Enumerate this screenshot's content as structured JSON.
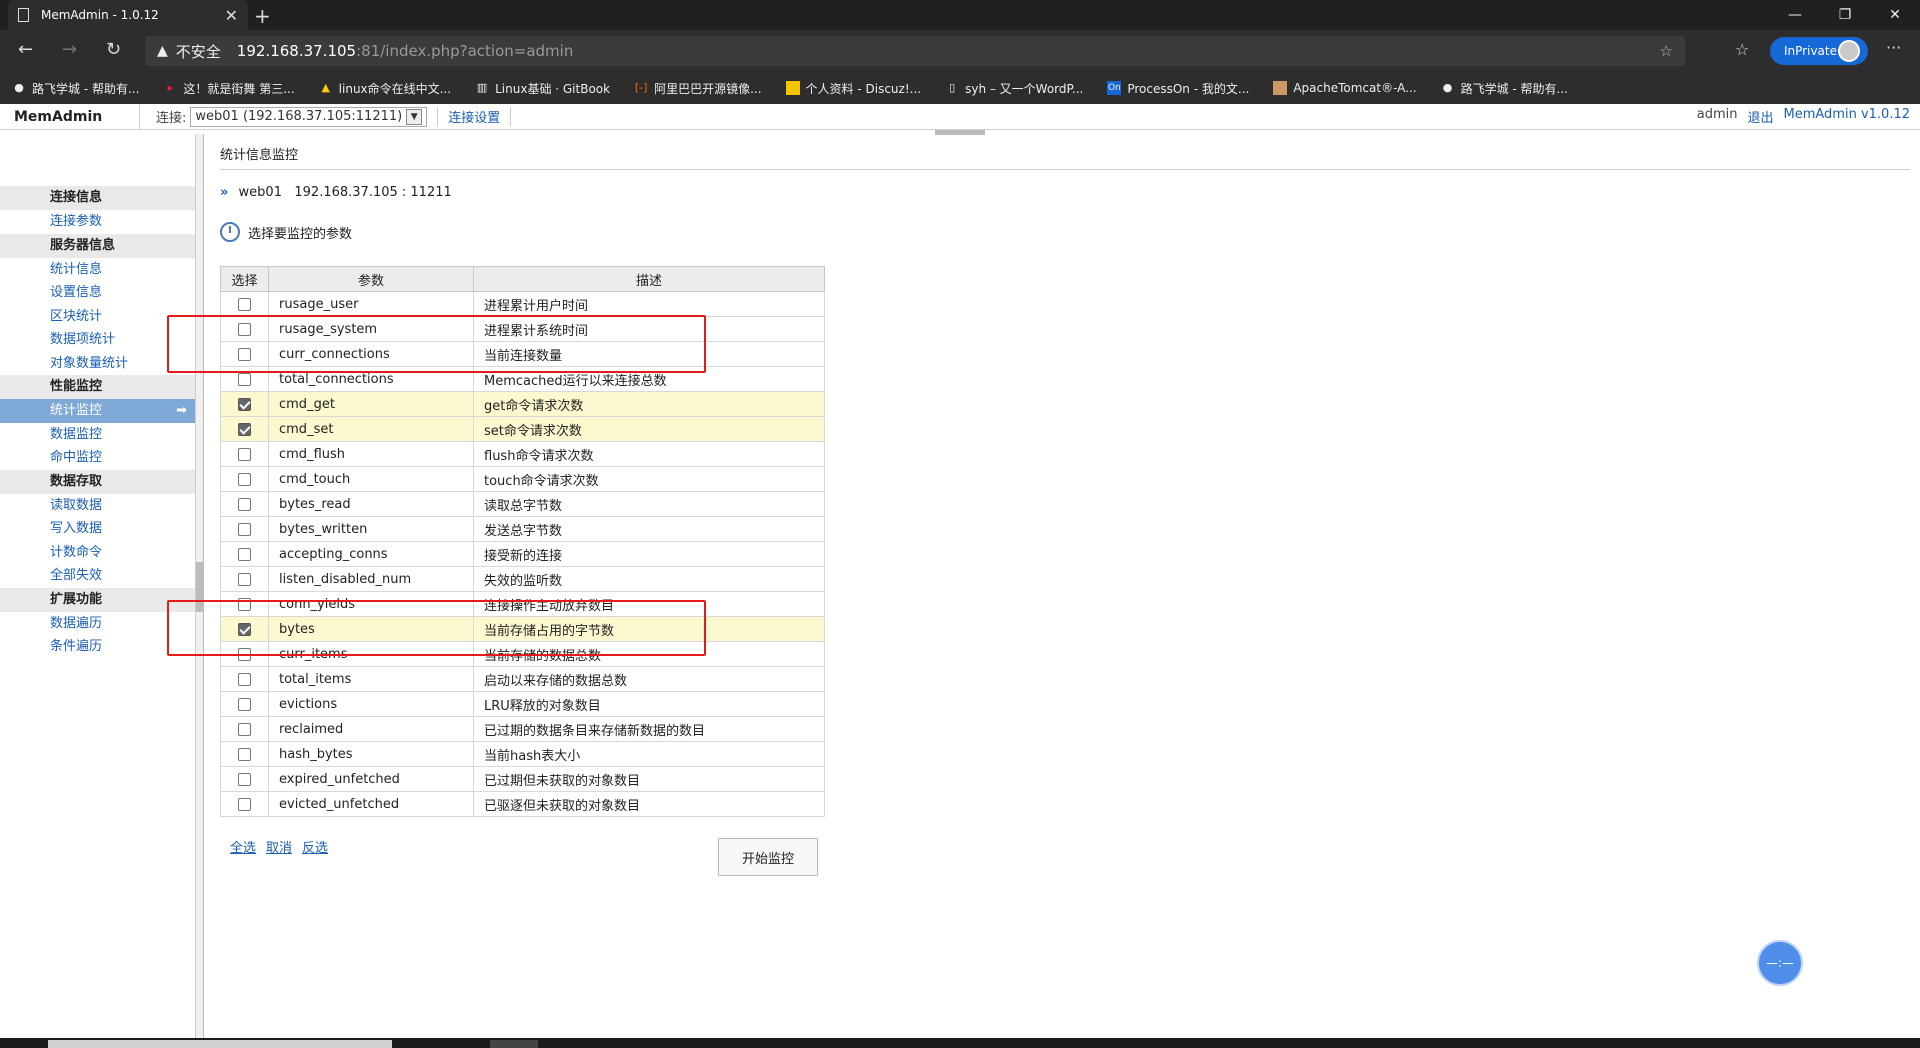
{
  "browser": {
    "tab_title": "MemAdmin - 1.0.12",
    "not_secure": "不安全",
    "url_host": "192.168.37.105",
    "url_rest": ":81/index.php?action=admin",
    "inprivate": "InPrivate",
    "bookmarks": [
      "路飞学城 - 帮助有...",
      "这！就是街舞 第三...",
      "linux命令在线中文...",
      "Linux基础 · GitBook",
      "阿里巴巴开源镜像...",
      "个人资料 - Discuz!...",
      "syh – 又一个WordP...",
      "ProcessOn - 我的文...",
      "ApacheTomcat®-A...",
      "路飞学城 - 帮助有..."
    ]
  },
  "app": {
    "brand": "MemAdmin",
    "conn_label": "连接:",
    "conn_value": "web01 (192.168.37.105:11211)",
    "conn_settings": "连接设置",
    "user": "admin",
    "logout": "退出",
    "version": "MemAdmin v1.0.12"
  },
  "sidebar": {
    "groups": [
      {
        "title": "连接信息",
        "items": [
          "连接参数"
        ]
      },
      {
        "title": "服务器信息",
        "items": [
          "统计信息",
          "设置信息",
          "区块统计",
          "数据项统计",
          "对象数量统计"
        ]
      },
      {
        "title": "性能监控",
        "items": [
          "统计监控",
          "数据监控",
          "命中监控"
        ]
      },
      {
        "title": "数据存取",
        "items": [
          "读取数据",
          "写入数据",
          "计数命令",
          "全部失效"
        ]
      },
      {
        "title": "扩展功能",
        "items": [
          "数据遍历",
          "条件遍历"
        ]
      }
    ],
    "active": "统计监控"
  },
  "main": {
    "title": "统计信息监控",
    "server_name": "web01",
    "server_addr": "192.168.37.105 : 11211",
    "choose_label": "选择要监控的参数",
    "columns": [
      "选择",
      "参数",
      "描述"
    ],
    "rows": [
      {
        "param": "rusage_user",
        "desc": "进程累计用户时间",
        "checked": false
      },
      {
        "param": "rusage_system",
        "desc": "进程累计系统时间",
        "checked": false
      },
      {
        "param": "curr_connections",
        "desc": "当前连接数量",
        "checked": false
      },
      {
        "param": "total_connections",
        "desc": "Memcached运行以来连接总数",
        "checked": false
      },
      {
        "param": "cmd_get",
        "desc": "get命令请求次数",
        "checked": true
      },
      {
        "param": "cmd_set",
        "desc": "set命令请求次数",
        "checked": true
      },
      {
        "param": "cmd_flush",
        "desc": "flush命令请求次数",
        "checked": false
      },
      {
        "param": "cmd_touch",
        "desc": "touch命令请求次数",
        "checked": false
      },
      {
        "param": "bytes_read",
        "desc": "读取总字节数",
        "checked": false
      },
      {
        "param": "bytes_written",
        "desc": "发送总字节数",
        "checked": false
      },
      {
        "param": "accepting_conns",
        "desc": "接受新的连接",
        "checked": false
      },
      {
        "param": "listen_disabled_num",
        "desc": "失效的监听数",
        "checked": false
      },
      {
        "param": "conn_yields",
        "desc": "连接操作主动放弃数目",
        "checked": false
      },
      {
        "param": "bytes",
        "desc": "当前存储占用的字节数",
        "checked": true
      },
      {
        "param": "curr_items",
        "desc": "当前存储的数据总数",
        "checked": false
      },
      {
        "param": "total_items",
        "desc": "启动以来存储的数据总数",
        "checked": false
      },
      {
        "param": "evictions",
        "desc": "LRU释放的对象数目",
        "checked": false
      },
      {
        "param": "reclaimed",
        "desc": "已过期的数据条目来存储新数据的数目",
        "checked": false
      },
      {
        "param": "hash_bytes",
        "desc": "当前hash表大小",
        "checked": false
      },
      {
        "param": "expired_unfetched",
        "desc": "已过期但未获取的对象数目",
        "checked": false
      },
      {
        "param": "evicted_unfetched",
        "desc": "已驱逐但未获取的对象数目",
        "checked": false
      }
    ],
    "select_all": "全选",
    "cancel": "取消",
    "invert": "反选",
    "start": "开始监控"
  },
  "colors": {
    "link": "#1a5fb4",
    "highlight": "#fcf8cf",
    "annotation": "#e31b1b"
  }
}
